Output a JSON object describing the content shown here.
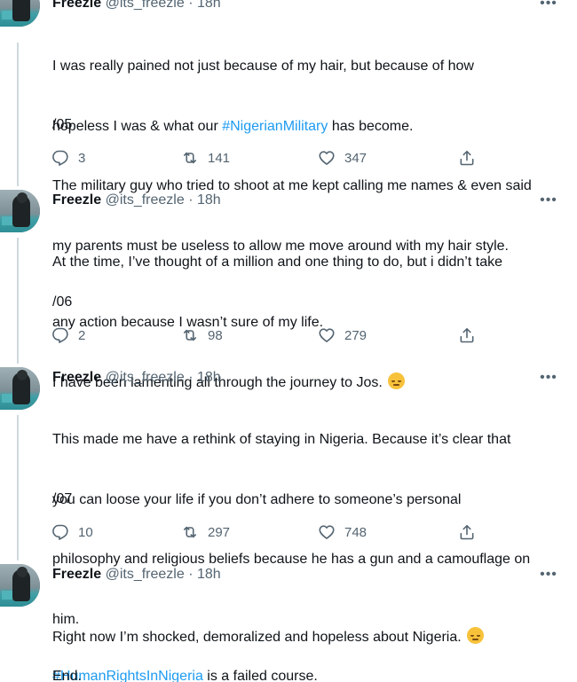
{
  "tweets": [
    {
      "name": "Freezle",
      "handle": "@its_freezle",
      "dot": "·",
      "time": "18h",
      "more": "•••",
      "line1": "I was really pained not just because of my hair, but because of how",
      "line2a": "hopeless I was & what our ",
      "hashtag": "#NigerianMilitary",
      "line2b": " has become.",
      "line3": "The military guy who tried to shoot at me kept calling me names & even said",
      "line4": "my parents must be useless to allow me move around with my hair style.",
      "number": "/05",
      "replies": "3",
      "retweets": "141",
      "likes": "347"
    },
    {
      "name": "Freezle",
      "handle": "@its_freezle",
      "dot": "·",
      "time": "18h",
      "more": "•••",
      "line1": "At the time, I’ve thought of a million and one thing to do, but i didn’t take",
      "line2": "any action because I wasn’t sure of my life.",
      "line3": "I have been lamenting all through the journey to Jos. ",
      "number": "/06",
      "replies": "2",
      "retweets": "98",
      "likes": "279"
    },
    {
      "name": "Freezle",
      "handle": "@its_freezle",
      "dot": "·",
      "time": "18h",
      "more": "•••",
      "line1": "This made me have a rethink of staying in Nigeria. Because it’s clear that",
      "line2": "you can loose your life if you don’t adhere to someone’s personal",
      "line3": "philosophy and religious beliefs because he has a gun and a camouflage on",
      "line4": "him.",
      "number": "/07",
      "replies": "10",
      "retweets": "297",
      "likes": "748"
    },
    {
      "name": "Freezle",
      "handle": "@its_freezle",
      "dot": "·",
      "time": "18h",
      "more": "•••",
      "line1": "Right now I’m shocked, demoralized and hopeless about Nigeria. ",
      "hashtag": "#HumanRightsInNigeria",
      "line2": " is a failed course.",
      "line3": "End."
    }
  ],
  "icons": {
    "reply": "reply-icon",
    "retweet": "retweet-icon",
    "like": "heart-icon",
    "share": "share-icon",
    "emoji": "pensive-face-emoji"
  },
  "colors": {
    "hashtag": "#1d9bf0",
    "secondary_text": "#536471",
    "thread_line": "#cfd9de"
  }
}
